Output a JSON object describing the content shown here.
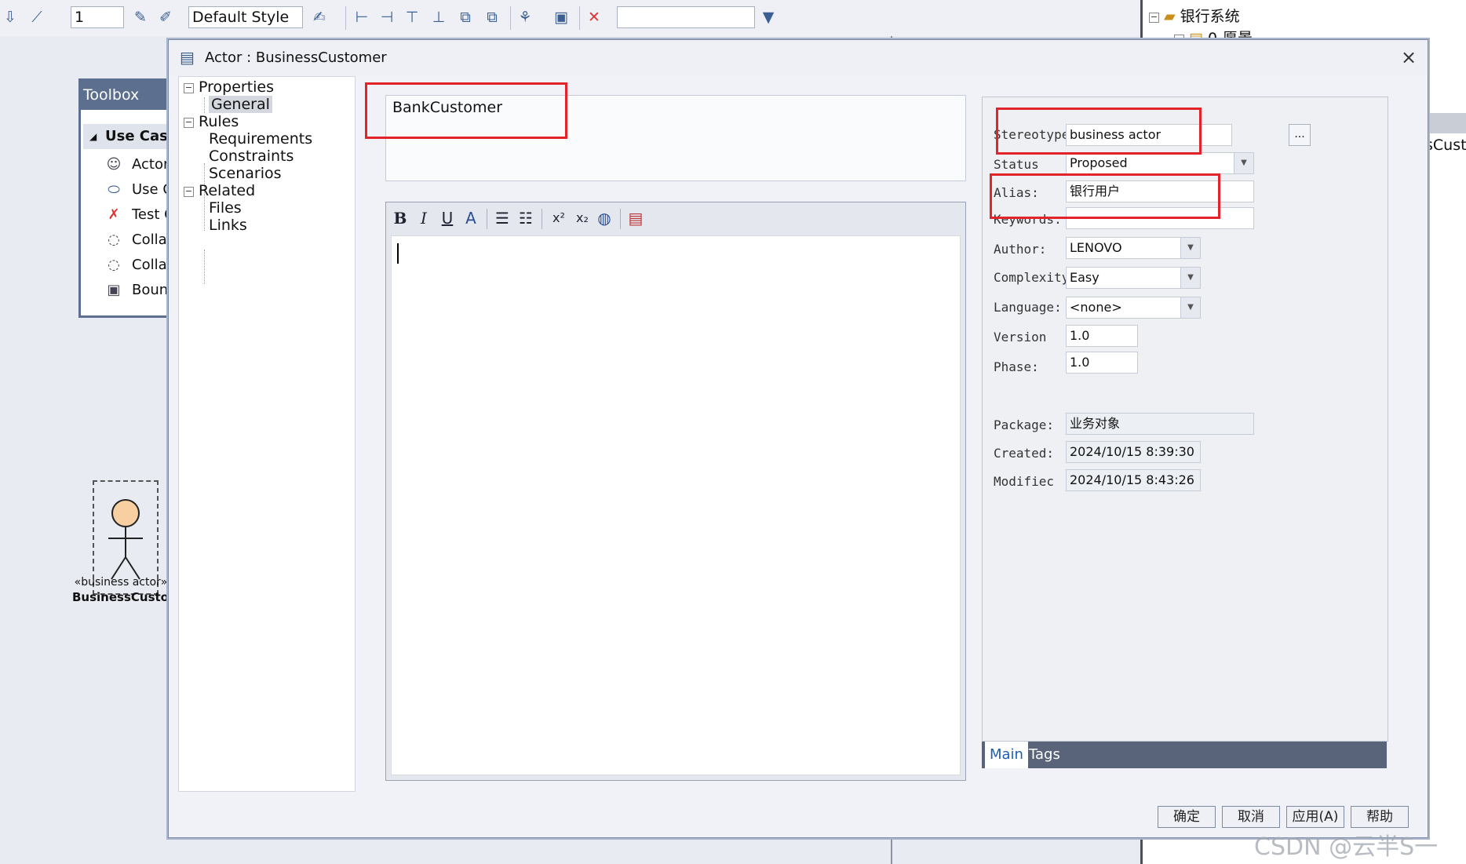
{
  "toolbar": {
    "spin_value": "1",
    "style_select": "Default Style",
    "search_value": ""
  },
  "project_tree": {
    "root": "银行系统",
    "child": "0-愿景",
    "partial_label": "sCusto"
  },
  "toolbox": {
    "title": "Toolbox",
    "section": "Use Case",
    "items": [
      "Actor",
      "Use C",
      "Test C",
      "Colla",
      "Colla",
      "Boun"
    ]
  },
  "diagram_actor": {
    "stereotype": "«business actor»",
    "name": "BusinessCustom"
  },
  "dialog": {
    "title": "Actor : BusinessCustomer",
    "close": "×",
    "nav": {
      "properties": "Properties",
      "general": "General",
      "rules": "Rules",
      "requirements": "Requirements",
      "constraints": "Constraints",
      "scenarios": "Scenarios",
      "related": "Related",
      "files": "Files",
      "links": "Links"
    },
    "name": "BankCustomer",
    "notes_text": "",
    "fields": {
      "stereotype_label": "Stereotype",
      "stereotype": "business actor",
      "stereotype_btn": "...",
      "status_label": "Status",
      "status": "Proposed",
      "alias_label": "Alias:",
      "alias": "银行用户",
      "keywords_label": "Keywords:",
      "keywords": "",
      "author_label": "Author:",
      "author": "LENOVO",
      "complexity_label": "Complexity",
      "complexity": "Easy",
      "language_label": "Language:",
      "language": "<none>",
      "version_label": "Version",
      "version": "1.0",
      "phase_label": "Phase:",
      "phase": "1.0",
      "package_label": "Package:",
      "package": "业务对象",
      "created_label": "Created:",
      "created": "2024/10/15 8:39:30",
      "modified_label": "Modifiec",
      "modified": "2024/10/15 8:43:26"
    },
    "tabs": [
      "Main",
      "Tags"
    ],
    "buttons": {
      "ok": "确定",
      "cancel": "取消",
      "apply": "应用(A)",
      "help": "帮助"
    }
  },
  "watermark": "CSDN @云半S一",
  "colors": {
    "highlight": "#e3232a",
    "tab_bar": "#59647b",
    "active_tab_text": "#1b5fb5"
  }
}
